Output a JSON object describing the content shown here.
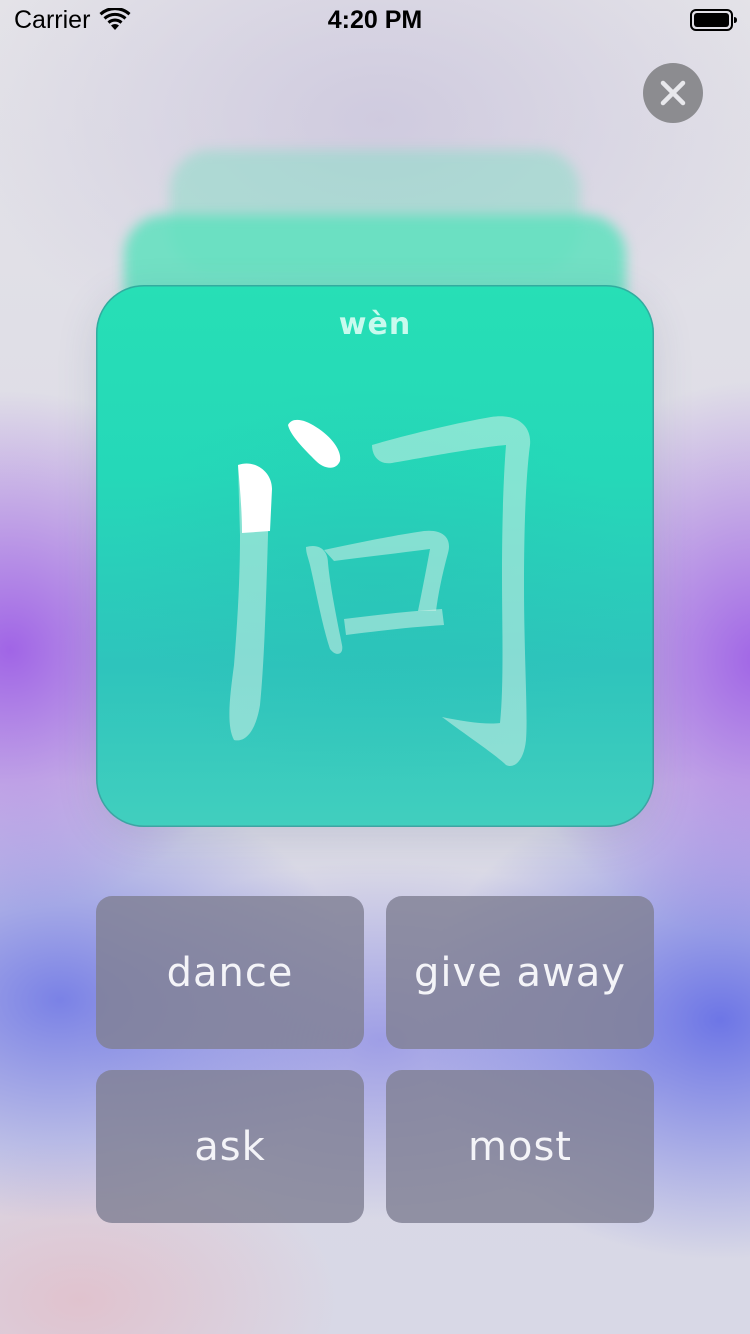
{
  "status_bar": {
    "carrier": "Carrier",
    "time": "4:20 PM",
    "wifi_icon": "wifi-icon",
    "battery_icon": "battery-icon"
  },
  "close_button": {
    "icon": "close-icon"
  },
  "card": {
    "pinyin": "wèn",
    "character": "问",
    "colors": {
      "card_top": "#27dfb6",
      "card_bottom": "#41cfbe",
      "stroke_highlight": "#ffffff"
    }
  },
  "answers": [
    {
      "label": "dance"
    },
    {
      "label": "give away"
    },
    {
      "label": "ask"
    },
    {
      "label": "most"
    }
  ]
}
